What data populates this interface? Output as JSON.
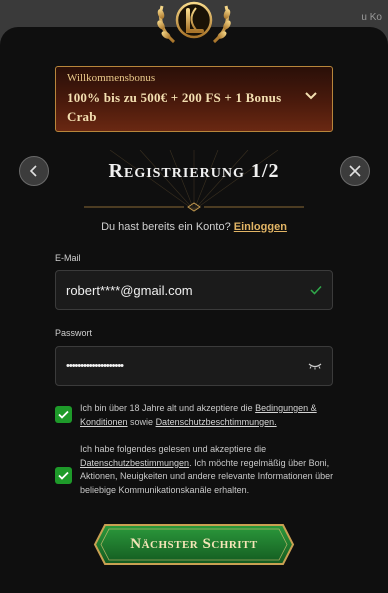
{
  "backdrop": {
    "text": "u Ko"
  },
  "bonus": {
    "label": "Willkommensbonus",
    "value": "100% bis zu 500€ + 200 FS + 1 Bonus Crab"
  },
  "header": {
    "title": "Registrierung 1/2"
  },
  "login": {
    "prompt": "Du hast bereits ein Konto?",
    "link": "Einloggen"
  },
  "email": {
    "label": "E-Mail",
    "value": "robert****@gmail.com"
  },
  "password": {
    "label": "Passwort",
    "value": "••••••••••••••••••••"
  },
  "consent1": {
    "text_before": "Ich bin über 18 Jahre alt und akzeptiere die ",
    "link1": "Bedingungen & Konditionen",
    "text_mid": " sowie ",
    "link2": "Datenschutzbeschtimmungen.",
    "checked": true
  },
  "consent2": {
    "text_before": "Ich habe folgendes gelesen und akzeptiere die ",
    "link": "Datenschutzbestimmungen",
    "text_after": ". Ich möchte regelmäßig über Boni, Aktionen, Neuigkeiten und andere relevante Informationen über beliebige Kommunikationskanäle erhalten.",
    "checked": true
  },
  "submit": {
    "label": "Nächster Schritt"
  },
  "colors": {
    "accent_gold": "#e2b565",
    "check_green": "#1e9a2a",
    "button_green": "#1c7a2c"
  }
}
